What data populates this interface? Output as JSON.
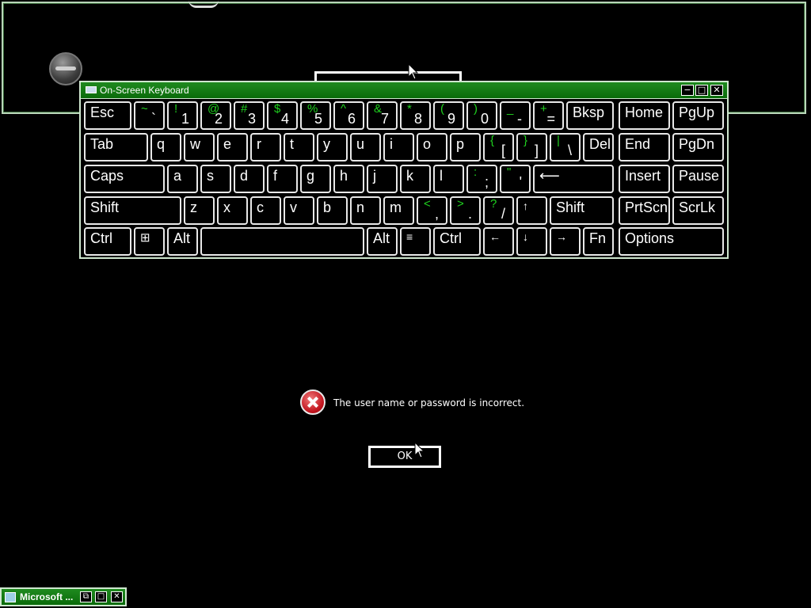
{
  "osk": {
    "title": "On-Screen Keyboard",
    "controls": {
      "minimize": "−",
      "maximize": "□",
      "close": "✕"
    },
    "keys": {
      "esc": "Esc",
      "k_grave": {
        "shift": "~",
        "low": "`"
      },
      "k1": {
        "shift": "!",
        "low": "1"
      },
      "k2": {
        "shift": "@",
        "low": "2"
      },
      "k3": {
        "shift": "#",
        "low": "3"
      },
      "k4": {
        "shift": "$",
        "low": "4"
      },
      "k5": {
        "shift": "%",
        "low": "5"
      },
      "k6": {
        "shift": "^",
        "low": "6"
      },
      "k7": {
        "shift": "&",
        "low": "7"
      },
      "k8": {
        "shift": "*",
        "low": "8"
      },
      "k9": {
        "shift": "(",
        "low": "9"
      },
      "k0": {
        "shift": ")",
        "low": "0"
      },
      "kminus": {
        "shift": "_",
        "low": "-"
      },
      "kequal": {
        "shift": "+",
        "low": "="
      },
      "bksp": "Bksp",
      "home": "Home",
      "pgup": "PgUp",
      "tab": "Tab",
      "q": "q",
      "w": "w",
      "e": "e",
      "r": "r",
      "t": "t",
      "y": "y",
      "u": "u",
      "i": "i",
      "o": "o",
      "p": "p",
      "klbracket": {
        "shift": "{",
        "low": "["
      },
      "krbracket": {
        "shift": "}",
        "low": "]"
      },
      "kbackslash": {
        "shift": "|",
        "low": "\\"
      },
      "del": "Del",
      "end": "End",
      "pgdn": "PgDn",
      "caps": "Caps",
      "a": "a",
      "s": "s",
      "d": "d",
      "f": "f",
      "g": "g",
      "h": "h",
      "j": "j",
      "k": "k",
      "l": "l",
      "ksemicolon": {
        "shift": ":",
        "low": ";"
      },
      "kquote": {
        "shift": "\"",
        "low": "'"
      },
      "enter": "⟵",
      "insert": "Insert",
      "pause": "Pause",
      "shift_left": "Shift",
      "z": "z",
      "x": "x",
      "c": "c",
      "v": "v",
      "b": "b",
      "n": "n",
      "m": "m",
      "kcomma": {
        "shift": "<",
        "low": ","
      },
      "kperiod": {
        "shift": ">",
        "low": "."
      },
      "kslash": {
        "shift": "?",
        "low": "/"
      },
      "up": "↑",
      "shift_right": "Shift",
      "prtscn": "PrtScn",
      "scrlk": "ScrLk",
      "ctrl_left": "Ctrl",
      "win": "⊞",
      "alt_left": "Alt",
      "space": "",
      "alt_right": "Alt",
      "menu": "≡",
      "ctrl_right": "Ctrl",
      "left": "←",
      "down": "↓",
      "right": "→",
      "fn": "Fn",
      "options": "Options"
    }
  },
  "dialog": {
    "message": "The user name or password is incorrect.",
    "ok_label": "OK"
  },
  "taskbar": {
    "label": "Microsoft ...",
    "controls": {
      "restore": "⧉",
      "maximize": "□",
      "close": "✕"
    }
  },
  "colors": {
    "accent_green": "#1fd31f",
    "titlebar_green": "#0a6b0a",
    "error_red": "#c2141e"
  }
}
